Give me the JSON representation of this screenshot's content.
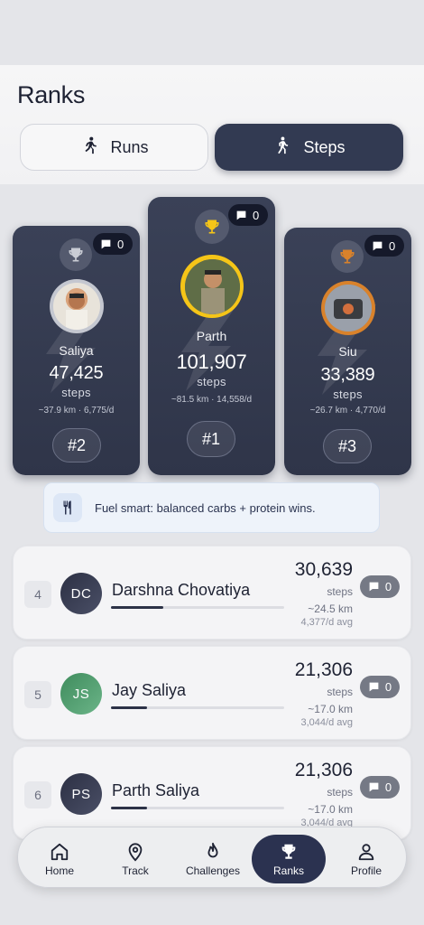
{
  "header": {
    "title": "Ranks",
    "tabs": [
      {
        "label": "Runs",
        "icon": "runner-icon",
        "active": false
      },
      {
        "label": "Steps",
        "icon": "walker-icon",
        "active": true
      }
    ]
  },
  "podium": [
    {
      "position": 2,
      "name": "Saliya",
      "steps": "47,425",
      "unit": "steps",
      "sub": "~37.9 km · 6,775/d",
      "rank_label": "#2",
      "comments": "0",
      "trophy_color": "#c9ccd4"
    },
    {
      "position": 1,
      "name": "Parth",
      "steps": "101,907",
      "unit": "steps",
      "sub": "~81.5 km · 14,558/d",
      "rank_label": "#1",
      "comments": "0",
      "trophy_color": "#f5c518"
    },
    {
      "position": 3,
      "name": "Siu",
      "steps": "33,389",
      "unit": "steps",
      "sub": "~26.7 km · 4,770/d",
      "rank_label": "#3",
      "comments": "0",
      "trophy_color": "#d9822b"
    }
  ],
  "tip": {
    "text": "Fuel smart: balanced carbs + protein wins.",
    "icon": "fork-knife-icon"
  },
  "leaderboard": [
    {
      "rank": "4",
      "initials": "DC",
      "name": "Darshna Chovatiya",
      "steps": "30,639",
      "unit": "steps",
      "km": "~24.5 km",
      "avg": "4,377/d avg",
      "comments": "0",
      "progress": 0.3,
      "avatar_color": "#3a3f55"
    },
    {
      "rank": "5",
      "initials": "JS",
      "name": "Jay Saliya",
      "steps": "21,306",
      "unit": "steps",
      "km": "~17.0 km",
      "avg": "3,044/d avg",
      "comments": "0",
      "progress": 0.21,
      "avatar_color": "#4c9a6a"
    },
    {
      "rank": "6",
      "initials": "PS",
      "name": "Parth Saliya",
      "steps": "21,306",
      "unit": "steps",
      "km": "~17.0 km",
      "avg": "3,044/d avg",
      "comments": "0",
      "progress": 0.21,
      "avatar_color": "#3a3f55"
    }
  ],
  "nav": [
    {
      "label": "Home",
      "icon": "home-icon",
      "active": false
    },
    {
      "label": "Track",
      "icon": "location-pin-icon",
      "active": false
    },
    {
      "label": "Challenges",
      "icon": "flame-icon",
      "active": false
    },
    {
      "label": "Ranks",
      "icon": "trophy-icon",
      "active": true
    },
    {
      "label": "Profile",
      "icon": "person-icon",
      "active": false
    }
  ]
}
